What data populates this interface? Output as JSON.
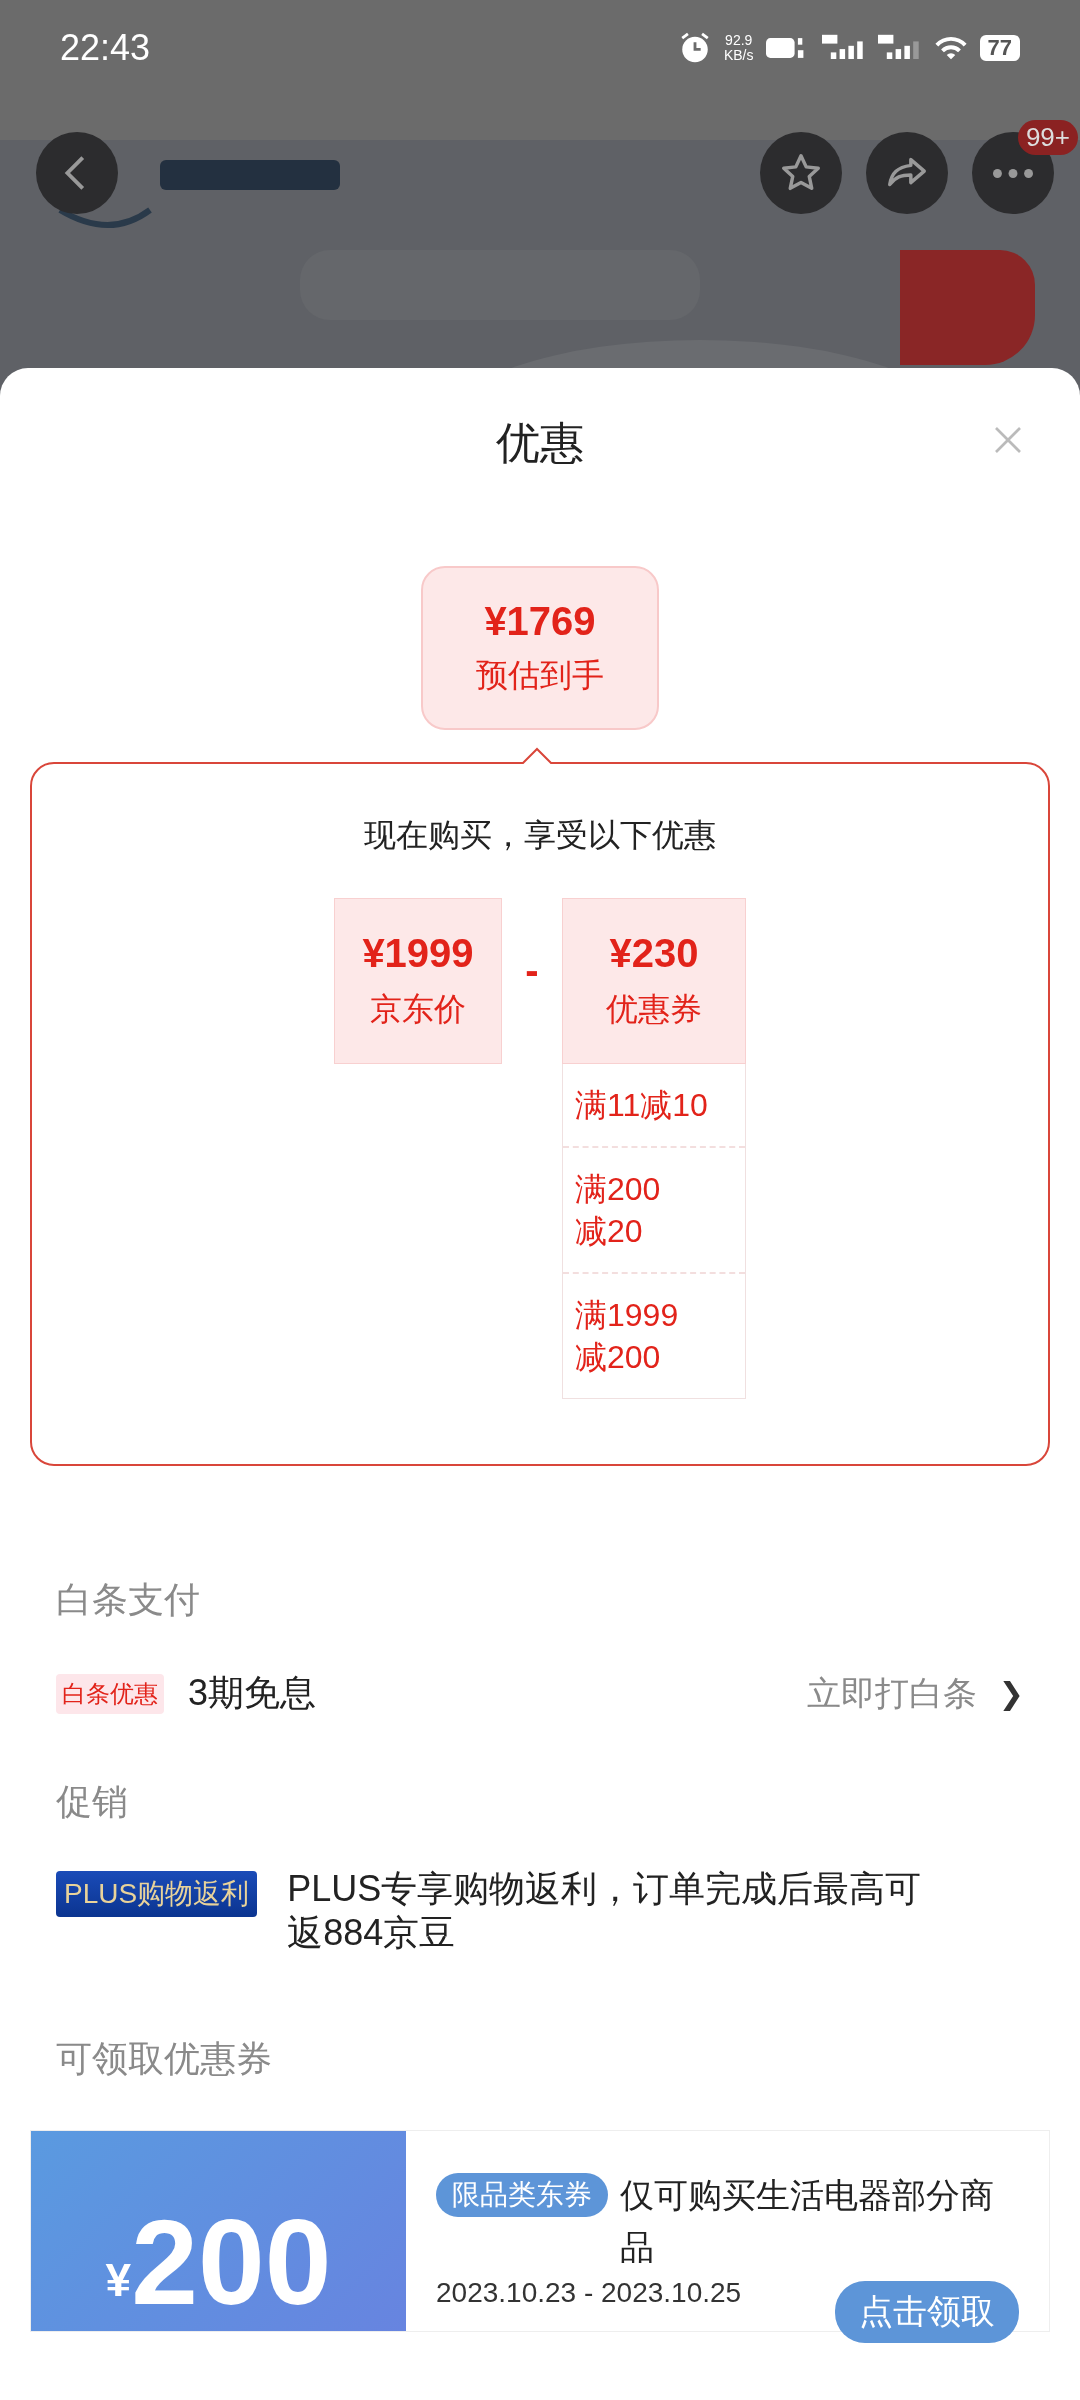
{
  "status_bar": {
    "time": "22:43",
    "net_speed": "92.9",
    "net_unit": "KB/s",
    "battery": "77"
  },
  "header": {
    "badge": "99+"
  },
  "sheet": {
    "title": "优惠"
  },
  "estimate": {
    "price": "¥1769",
    "label": "预估到手"
  },
  "breakdown": {
    "heading": "现在购买，享受以下优惠",
    "base": {
      "price": "¥1999",
      "label": "京东价"
    },
    "operator": "-",
    "discount": {
      "price": "¥230",
      "label": "优惠券"
    },
    "coupons": [
      {
        "lines": [
          "满11减10"
        ]
      },
      {
        "lines": [
          "满200",
          "减20"
        ]
      },
      {
        "lines": [
          "满1999",
          "减200"
        ]
      }
    ]
  },
  "baitiao": {
    "title": "白条支付",
    "tag": "白条优惠",
    "text": "3期免息",
    "link": "立即打白条",
    "chevron": "❯"
  },
  "promotion": {
    "title": "促销",
    "tag": "PLUS购物返利",
    "text": "PLUS专享购物返利，订单完成后最高可返884京豆"
  },
  "coupon_section": {
    "title": "可领取优惠券",
    "coupon": {
      "currency": "¥",
      "amount": "200",
      "tag": "限品类东券",
      "text": "仅可购买生活电器部分商品",
      "dates": "2023.10.23 - 2023.10.25",
      "button": "点击领取"
    }
  }
}
